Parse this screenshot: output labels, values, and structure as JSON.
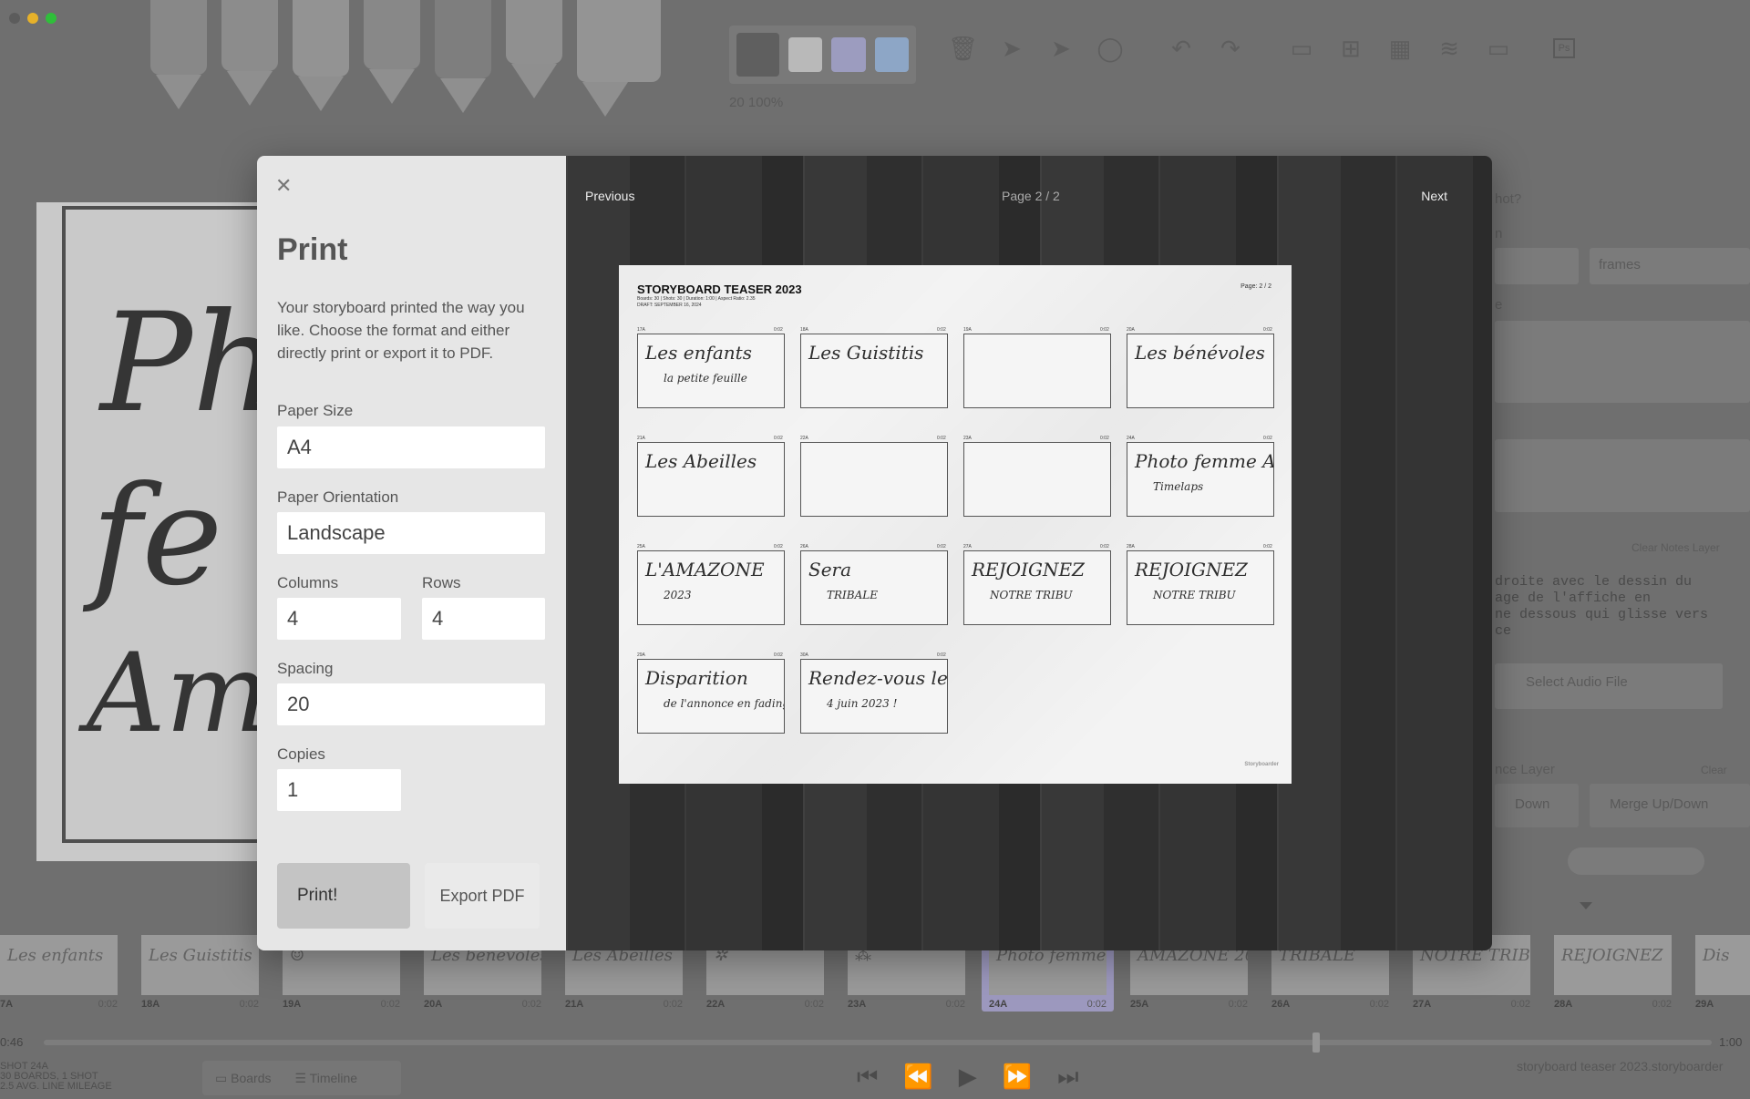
{
  "background": {
    "brush": {
      "size": "20",
      "opacity": "100%"
    },
    "colors": {
      "swatch_active": "#5f5f5f",
      "swatch_1": "#b9b9b9",
      "swatch_2": "#9c9cbf",
      "swatch_3": "#8da6c6"
    },
    "toolbar_icons": [
      "trash-icon",
      "move-icon",
      "scale-icon",
      "lasso-icon",
      "undo-icon",
      "redo-icon",
      "grid-1-icon",
      "grid-2-icon",
      "grid-3-icon",
      "layers-icon",
      "caption-icon",
      "photoshop-icon"
    ],
    "ps_label": "Ps",
    "right_panel": {
      "q": "hot?",
      "n_label": "n",
      "frames_placeholder": "frames",
      "e_label": "e",
      "clear_notes_layer": "Clear Notes Layer",
      "notes": [
        "droite avec le dessin du",
        "age de l'affiche en",
        "ne dessous qui glisse vers",
        "ce"
      ],
      "select_audio": "Select Audio File",
      "layer_label": "nce Layer",
      "clear": "Clear",
      "down_btn": "Down",
      "merge_btn": "Merge Up/Down"
    },
    "thumbnails": [
      {
        "label": "7A",
        "dur": "0:02",
        "sketch": "Les enfants"
      },
      {
        "label": "18A",
        "dur": "0:02",
        "sketch": "Les Guistitis"
      },
      {
        "label": "19A",
        "dur": "0:02",
        "sketch": "☺"
      },
      {
        "label": "20A",
        "dur": "0:02",
        "sketch": "Les bénévoles"
      },
      {
        "label": "21A",
        "dur": "0:02",
        "sketch": "Les Abeilles"
      },
      {
        "label": "22A",
        "dur": "0:02",
        "sketch": "✲"
      },
      {
        "label": "23A",
        "dur": "0:02",
        "sketch": "⁂"
      },
      {
        "label": "24A",
        "dur": "0:02",
        "sketch": "Photo femme"
      },
      {
        "label": "25A",
        "dur": "0:02",
        "sketch": "AMAZONE 2023"
      },
      {
        "label": "26A",
        "dur": "0:02",
        "sketch": "TRIBALE"
      },
      {
        "label": "27A",
        "dur": "0:02",
        "sketch": "NOTRE TRIBU"
      },
      {
        "label": "28A",
        "dur": "0:02",
        "sketch": "REJOIGNEZ"
      },
      {
        "label": "29A",
        "dur": "0:02",
        "sketch": "Dis"
      }
    ],
    "time_start": "0:46",
    "time_end": "1:00",
    "shot_info": [
      "SHOT 24A",
      "30 BOARDS, 1 SHOT",
      "2.5 AVG. LINE MILEAGE"
    ],
    "view_tabs": {
      "boards": "Boards",
      "timeline": "Timeline"
    },
    "project_name": "storyboard teaser 2023.storyboarder"
  },
  "modal": {
    "title": "Print",
    "description": "Your storyboard printed the way you like. Choose the format and either directly print or export it to PDF.",
    "paper_size_label": "Paper Size",
    "paper_size": "A4",
    "orientation_label": "Paper Orientation",
    "orientation": "Landscape",
    "columns_label": "Columns",
    "columns": "4",
    "rows_label": "Rows",
    "rows": "4",
    "spacing_label": "Spacing",
    "spacing": "20",
    "copies_label": "Copies",
    "copies": "1",
    "print_btn": "Print!",
    "export_btn": "Export PDF",
    "prev": "Previous",
    "next": "Next",
    "page_indicator": "Page 2 / 2"
  },
  "preview": {
    "title": "STORYBOARD TEASER 2023",
    "meta_line1": "Boards: 30 | Shots: 30 | Duration: 1:00 | Aspect Ratio: 2.35",
    "meta_line2": "DRAFT: SEPTEMBER 16, 2024",
    "page": "Page: 2 / 2",
    "brand": "Storyboarder",
    "boards": [
      {
        "no": "17A",
        "time": "0:02",
        "text": "Les enfants",
        "text2": "la petite feuille"
      },
      {
        "no": "18A",
        "time": "0:02",
        "text": "Les Guistitis",
        "text2": ""
      },
      {
        "no": "19A",
        "time": "0:02",
        "text": "",
        "text2": ""
      },
      {
        "no": "20A",
        "time": "0:02",
        "text": "Les bénévoles",
        "text2": ""
      },
      {
        "no": "21A",
        "time": "0:02",
        "text": "Les Abeilles",
        "text2": ""
      },
      {
        "no": "22A",
        "time": "0:02",
        "text": "",
        "text2": ""
      },
      {
        "no": "23A",
        "time": "0:02",
        "text": "",
        "text2": ""
      },
      {
        "no": "24A",
        "time": "0:02",
        "text": "Photo femme Amazonienne",
        "text2": "Timelaps"
      },
      {
        "no": "25A",
        "time": "0:02",
        "text": "L'AMAZONE",
        "text2": "2023"
      },
      {
        "no": "26A",
        "time": "0:02",
        "text": "Sera",
        "text2": "TRIBALE"
      },
      {
        "no": "27A",
        "time": "0:02",
        "text": "REJOIGNEZ",
        "text2": "NOTRE TRIBU"
      },
      {
        "no": "28A",
        "time": "0:02",
        "text": "REJOIGNEZ",
        "text2": "NOTRE TRIBU"
      },
      {
        "no": "29A",
        "time": "0:02",
        "text": "Disparition",
        "text2": "de l'annonce en fading"
      },
      {
        "no": "30A",
        "time": "0:02",
        "text": "Rendez-vous le",
        "text2": "4 juin 2023 !"
      }
    ]
  }
}
